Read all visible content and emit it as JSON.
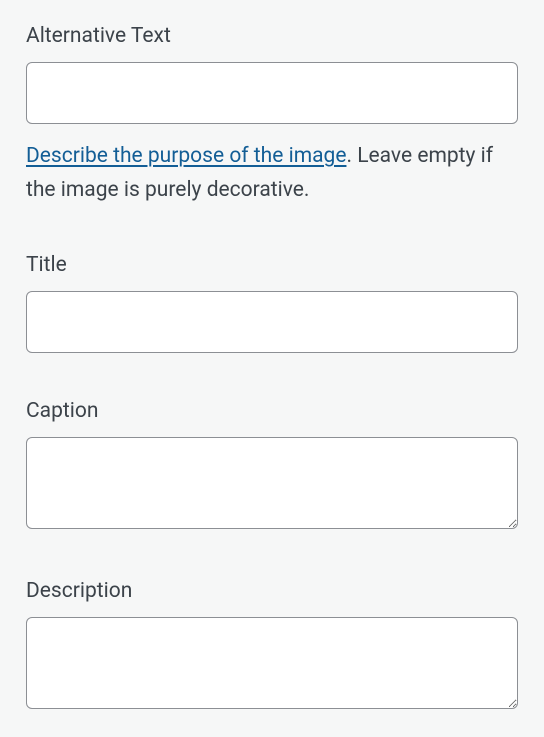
{
  "fields": {
    "alt_text": {
      "label": "Alternative Text",
      "value": "",
      "help_link_text": "Describe the purpose of the image",
      "help_suffix": ". Leave empty if the image is purely decorative."
    },
    "title": {
      "label": "Title",
      "value": ""
    },
    "caption": {
      "label": "Caption",
      "value": ""
    },
    "description": {
      "label": "Description",
      "value": ""
    }
  }
}
